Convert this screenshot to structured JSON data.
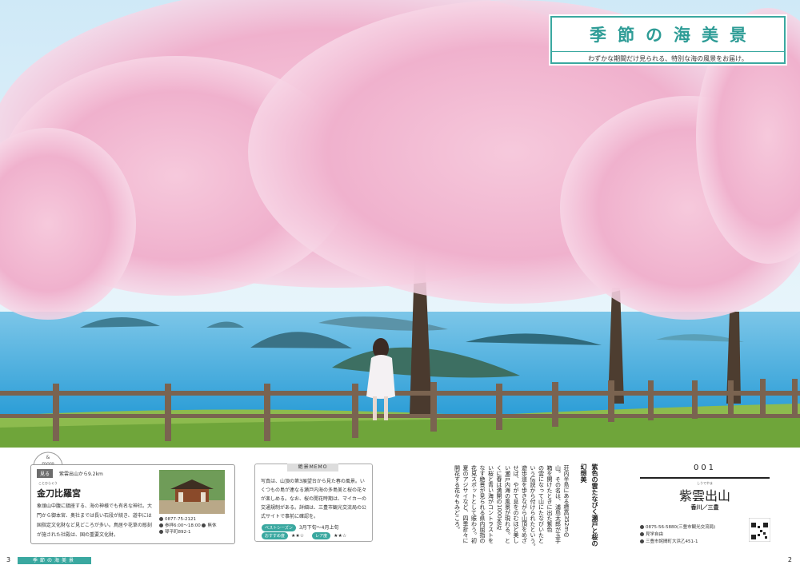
{
  "banner": {
    "title": "季節の海美景",
    "subtitle": "わずかな期間だけ見られる、特別な海の風景をお届け。"
  },
  "more": {
    "badge": "&more",
    "tag": "見る",
    "distance": "紫雲出山から9.2km",
    "furigana": "ことひらぐう",
    "name": "金刀比羅宮",
    "description": "象頭山中腹に鎮座する、海の神様でも有名な神社。大門から御本宮、奥社までは長い石段が続き、道中には国指定文化財など見どころが多い。鳥居や花草の彫刻が施された社殿は、国の重要文化財。",
    "phone": "0877-75-2121",
    "hours": "参拝6:00～18:00",
    "closed": "無休",
    "address": "琴平町892-1"
  },
  "memo": {
    "title": "絶景MEMO",
    "body": "写真は、山頂の第3展望台から見た春の風景。いくつもの島が連なる瀬戸内海の多島美と桜の花々が楽しめる。なお、桜の開花時期は、マイカーの交通規制がある。詳細は、三豊市観光交流局の公式サイトで事前に確認を。",
    "best_label": "ベストシーズン",
    "best_value": "3月下旬～4月上旬",
    "rec_label": "おすすめ度",
    "rec_value": "★★☆",
    "crowd_label": "レア度",
    "crowd_value": "★★☆"
  },
  "article": {
    "heading": "紫色の雲たなびく瀬戸と桜の幻想美",
    "columns": [
      "荘内半島にある標高352mの",
      "山。その名は、浦島太郎が玉手",
      "箱を開けたときに出た紫色",
      "の雲になって山にたなびいたと",
      "いう伝説から付けられたという。",
      "遊歩道を歩きながら山頂をめざ",
      "せば、やがて息をのむほど美し",
      "い瀬戸内海の風景が現れる。と",
      "くに春は満開の1000本近",
      "い桜と青い海がコントラストを",
      "なす絶景が見られる県内屈指の",
      "花見スポットとして賑わう。初",
      "夏のアジサイなど、四季折々に",
      "開花する花々もみどころ。"
    ]
  },
  "spot": {
    "number": "001",
    "furigana": "しうでやま",
    "name": "紫雲出山",
    "region": "香川／三豊",
    "phone": "0875-56-5880(三豊市観光交流局)",
    "access": "見学自由",
    "address": "三豊市詫間町大浜乙451-1"
  },
  "footer": {
    "page_left": "3",
    "page_right": "2",
    "section": "季節の海美景"
  },
  "colors": {
    "accent": "#3aa8a0",
    "sakura": "#f2b8d2",
    "sea": "#3fa6d6"
  }
}
